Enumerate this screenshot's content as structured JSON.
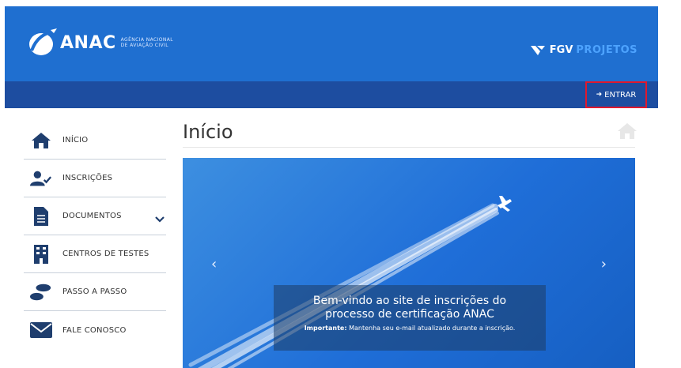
{
  "header": {
    "logo_name": "ANAC",
    "logo_sub_line1": "AGÊNCIA NACIONAL",
    "logo_sub_line2": "DE AVIAÇÃO CIVIL",
    "partner_a": "FGV",
    "partner_b": "PROJETOS",
    "color_primary": "#1f6fd0",
    "color_nav": "#1d4da0"
  },
  "navbar": {
    "login_label": "ENTRAR",
    "login_icon": "sign-in-icon"
  },
  "sidebar": {
    "items": [
      {
        "label": "INÍCIO",
        "icon": "home-icon"
      },
      {
        "label": "INSCRIÇÕES",
        "icon": "user-check-icon"
      },
      {
        "label": "DOCUMENTOS",
        "icon": "document-icon",
        "has_submenu": true
      },
      {
        "label": "CENTROS DE TESTES",
        "icon": "building-icon"
      },
      {
        "label": "PASSO A PASSO",
        "icon": "footsteps-icon"
      },
      {
        "label": "FALE CONOSCO",
        "icon": "envelope-icon"
      }
    ]
  },
  "main": {
    "title": "Início",
    "carousel": {
      "prev": "‹",
      "next": "›",
      "caption_line1": "Bem-vindo ao site de inscrições do",
      "caption_line2": "processo de certificação ANAC",
      "caption_strong": "Importante:",
      "caption_sub": " Mantenha seu e-mail atualizado durante a inscrição."
    }
  }
}
